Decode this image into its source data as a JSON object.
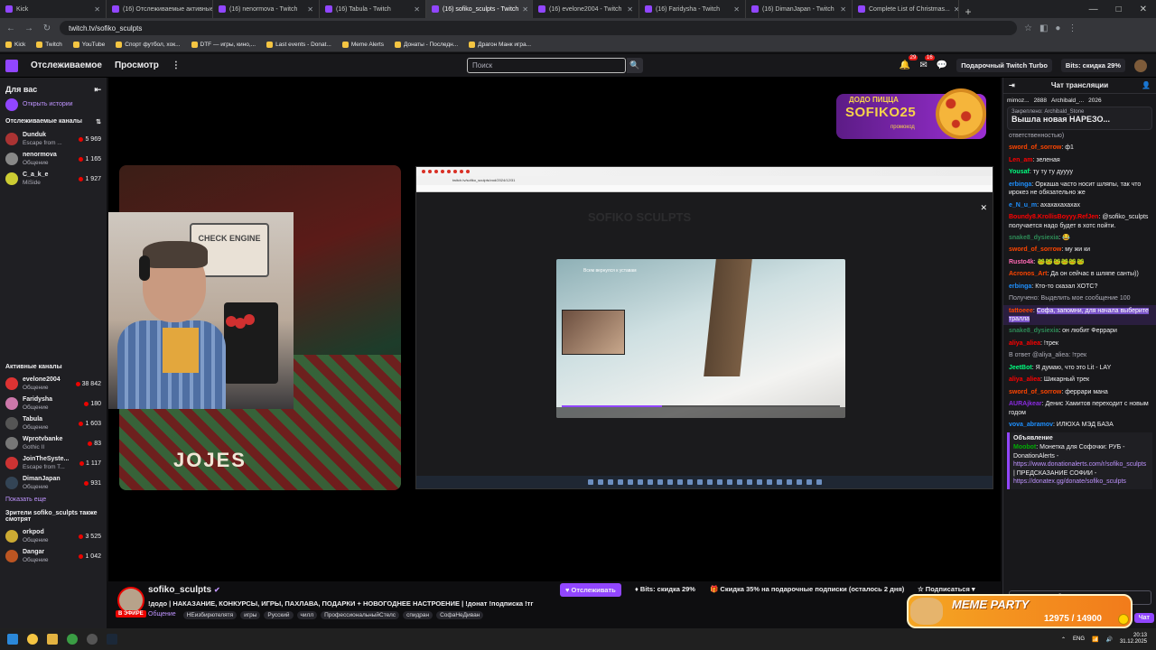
{
  "browser": {
    "tabs": [
      {
        "title": "Kick",
        "active": false
      },
      {
        "title": "(16) Отслеживаемые активные...",
        "active": false
      },
      {
        "title": "(16) nenormova - Twitch",
        "active": false
      },
      {
        "title": "(16) Tabula - Twitch",
        "active": false
      },
      {
        "title": "(16) sofiko_sculpts - Twitch",
        "active": true
      },
      {
        "title": "(16) evelone2004 - Twitch",
        "active": false
      },
      {
        "title": "(16) Faridysha - Twitch",
        "active": false
      },
      {
        "title": "(16) DimanJapan - Twitch",
        "active": false
      },
      {
        "title": "Complete List of Christmas...",
        "active": false
      }
    ],
    "new_tab": "+",
    "window_controls": [
      "—",
      "□",
      "✕"
    ],
    "url": "twitch.tv/sofiko_sculpts",
    "bookmarks": [
      "Kick",
      "Twitch",
      "YouTube",
      "Спорт футбол, хок...",
      "DTF — игры, кино,...",
      "Last events - Donat...",
      "Meme Alerts",
      "Донаты - Последн...",
      "Драгон Манк игра..."
    ]
  },
  "topnav": {
    "following": "Отслеживаемое",
    "browse": "Просмотр",
    "more": "⋮",
    "search_placeholder": "Поиск",
    "search_icon": "🔍",
    "notif_badge": "29",
    "inbox_badge": "16",
    "gift_turbo": "Подарочный Twitch Turbo",
    "bits_discount": "Bits: скидка 29%"
  },
  "sidebar": {
    "for_you": "Для вас",
    "collapse_icon": "⇤",
    "open_stories": "Открыть истории",
    "followed_title": "Отслеживаемые каналы",
    "sort_icon": "⇅",
    "followed": [
      {
        "name": "Dunduk",
        "game": "Escape from ...",
        "viewers": "5 969",
        "color": "#a33"
      },
      {
        "name": "nenormova",
        "game": "Общение",
        "viewers": "1 165",
        "color": "#888"
      },
      {
        "name": "C_a_k_e",
        "game": "MiSide",
        "viewers": "1 927",
        "color": "#cc3"
      }
    ],
    "active_title": "Активные каналы",
    "active": [
      {
        "name": "evelone2004",
        "game": "Общение",
        "viewers": "38 842",
        "color": "#d33"
      },
      {
        "name": "Faridysha",
        "game": "Общение",
        "viewers": "180",
        "color": "#c7a"
      },
      {
        "name": "Tabula",
        "game": "Общение",
        "viewers": "1 603",
        "color": "#555"
      },
      {
        "name": "Wprotvbanke",
        "game": "Gothic II",
        "viewers": "83",
        "color": "#777"
      },
      {
        "name": "JoinTheSyste...",
        "game": "Escape from T...",
        "viewers": "1 117",
        "color": "#c33"
      },
      {
        "name": "DimanJapan",
        "game": "Общение",
        "viewers": "931",
        "color": "#345"
      }
    ],
    "show_more": "Показать еще",
    "viewers_also_title": "Зрители sofiko_sculpts также смотрят",
    "viewers_also": [
      {
        "name": "orkpod",
        "game": "Общение",
        "viewers": "3 525",
        "color": "#ca3"
      },
      {
        "name": "Dangar",
        "game": "Общение",
        "viewers": "1 042",
        "color": "#b52"
      }
    ]
  },
  "player": {
    "sweater_text": "JOJES",
    "board_text": "CHECK ENGINE",
    "promo_top": "ДОДО ПИЦЦА",
    "promo_code": "SOFIKO25",
    "promo_label": "промокод",
    "shared_url": "twitch.tv/sofiko_sculpts/vod/2024/12/31",
    "shared_title": "Всем вернулся к уставам",
    "shared_watermark": "SOFIKO SCULPTS",
    "shared_progress": 0.36
  },
  "channel": {
    "name": "sofiko_sculpts",
    "verified_icon": "✔",
    "live": "В ЭФИРЕ",
    "title": "!додо | НАКАЗАНИЕ, КОНКУРСЫ, ИГРЫ, ПАХЛАВА, ПОДАРКИ + НОВОГОДНЕЕ НАСТРОЕНИЕ | !донат !подписка !тг",
    "category": "Общение",
    "tags": [
      "НЕизбирютелятя",
      "игры",
      "Русский",
      "чилл",
      "ПрофессиональныйСтелс",
      "спидран",
      "СофаНеДиван"
    ],
    "follow": "♥ Отслеживать",
    "bits": "♦ Bits: скидка 29%",
    "gift": "🎁 Скидка 35% на подарочные подписки (осталось 2 дня)",
    "subscribe": "☆ Подписаться ▾"
  },
  "chat": {
    "title": "Чат трансляции",
    "top_gifters": [
      "mimoz...",
      "2888",
      "Archibald_...",
      "2026"
    ],
    "pinned_by": "Закреплено: Archibald_Stone",
    "pinned_text": "Вышла новая НАРЕЗО...",
    "messages": [
      {
        "user": "",
        "color": "#adadb8",
        "text": "ответственностью)"
      },
      {
        "user": "sword_of_sorrow",
        "color": "#ff4500",
        "text": "ф1"
      },
      {
        "user": "Len_am",
        "color": "#ff0000",
        "text": "зеленая"
      },
      {
        "user": "Yousaf",
        "color": "#00ff7f",
        "text": "ту ту ту дуууу"
      },
      {
        "user": "erbinga",
        "color": "#1e90ff",
        "text": "Оркаша часто носит шляпы, так что ирокез не обязательно же"
      },
      {
        "user": "e_N_u_m",
        "color": "#1e90ff",
        "text": "ахахахахахах"
      },
      {
        "user": "Boundy8.KrollisBoyyy.RefJen",
        "color": "#ff0000",
        "text": "@sofiko_sculpts получается надо будет в хотс пойти."
      },
      {
        "user": "snake8_dysiexia",
        "color": "#2e8b57",
        "text": "😂"
      },
      {
        "user": "sword_of_sorrow",
        "color": "#ff4500",
        "text": "му жи ки"
      },
      {
        "user": "Rusto4k",
        "color": "#ff69b4",
        "text": "🐸🐸🐸🐸🐸🐸"
      },
      {
        "user": "Acronos_Art",
        "color": "#ff4500",
        "text": "Да он сейчас в шляпе санты))"
      },
      {
        "user": "erbinga",
        "color": "#1e90ff",
        "text": "Кто-то сказал ХОТС?"
      }
    ],
    "redeem": "Получено: Выделить мое сообщение  100",
    "highlight_user": "tattoeee",
    "highlight_text": "Софа, запомни, для начала выберите тралла",
    "messages2": [
      {
        "user": "snake8_dysiexia",
        "color": "#2e8b57",
        "text": "он любит Феррари"
      },
      {
        "user": "aliya_aliea",
        "color": "#ff0000",
        "text": "!трек"
      },
      {
        "user": "",
        "color": "#adadb8",
        "text": "В ответ @aliya_aliea: !трек"
      },
      {
        "user": "JeetBot",
        "color": "#00ff7f",
        "text": "Я думаю, что это Lit - LAY"
      },
      {
        "user": "aliya_aliea",
        "color": "#ff0000",
        "text": "Шикарный трек"
      },
      {
        "user": "sword_of_sorrow",
        "color": "#ff4500",
        "text": "феррари мана"
      },
      {
        "user": "AURAjkear",
        "color": "#8a2be2",
        "text": "Денис Хамитов переходит с новым годом"
      },
      {
        "user": "vova_abramov",
        "color": "#1e90ff",
        "text": "ИЛЮХА МЭД БАЗА"
      }
    ],
    "announce_title": "Объявление",
    "announce_user": "Moobot",
    "announce_text": "Монетка для Софочки: РУБ - DonationAlerts -",
    "announce_link1": "https://www.donationalerts.com/r/sofiko_sculpts",
    "announce_mid": "| ПРЕДСКАЗАНИЕ СОФИИ -",
    "announce_link2": "https://donatex.gg/donate/sofiko_sculpts",
    "input_placeholder": "Отправить сообщение",
    "send": "Чат"
  },
  "meme_party": {
    "title": "MEME PARTY",
    "progress_text": "12975 / 14900",
    "progress": 0.87
  },
  "taskbar": {
    "lang": "ENG",
    "time": "20:13",
    "date": "31.12.2025"
  }
}
